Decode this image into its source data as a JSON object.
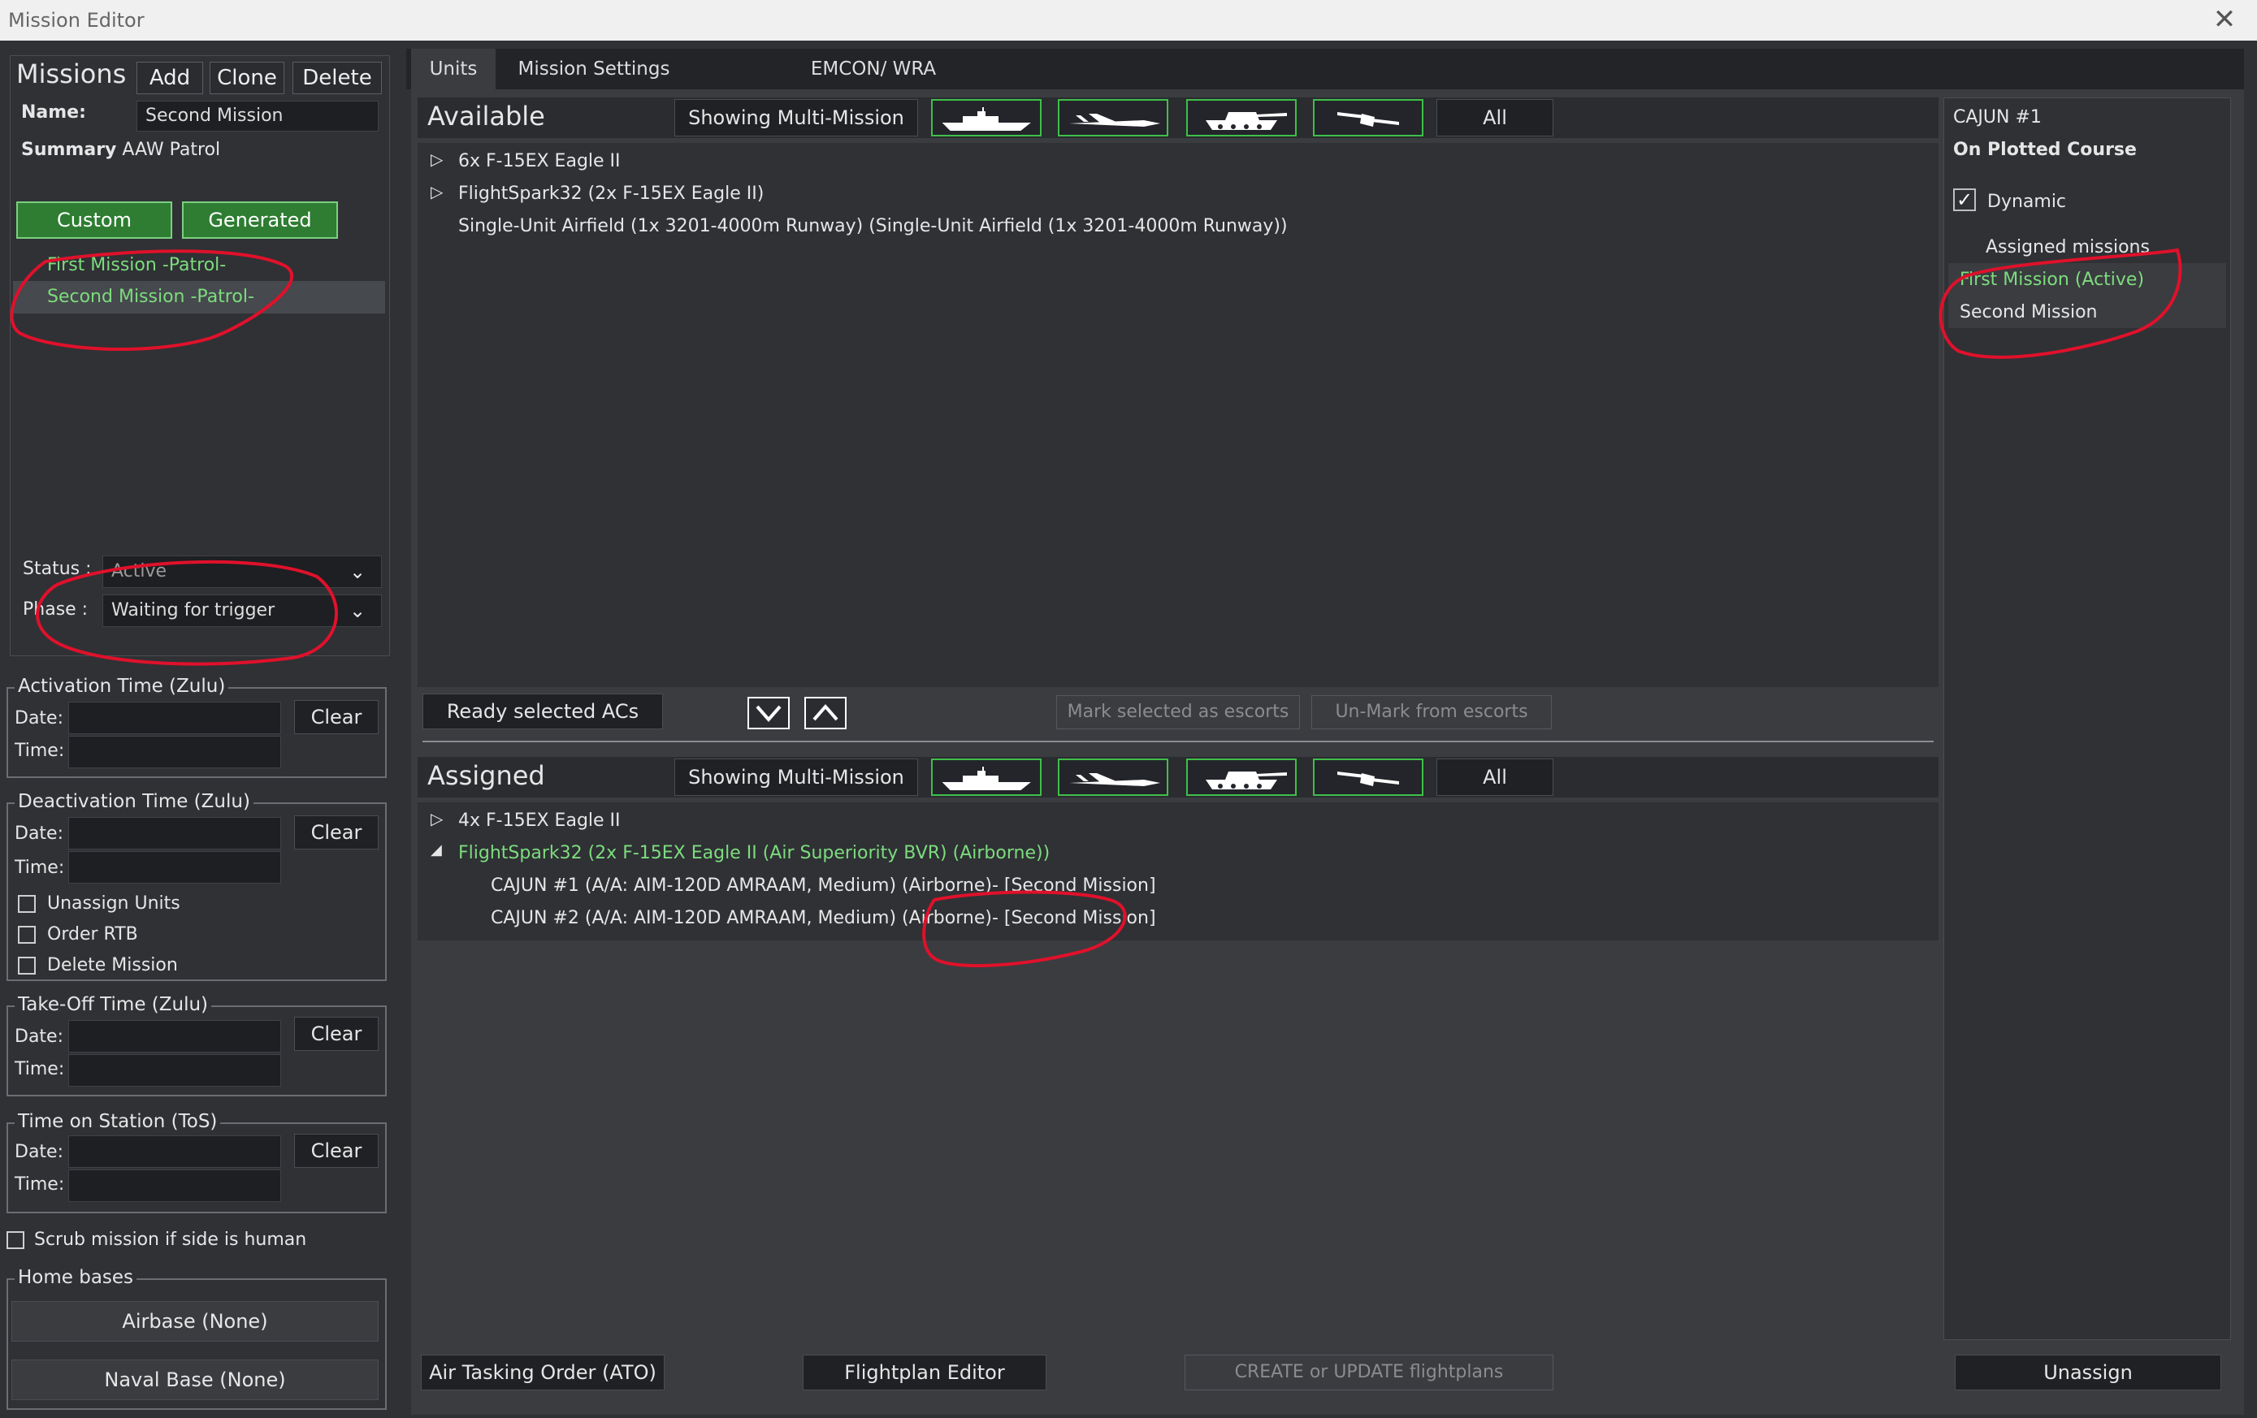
{
  "window": {
    "title": "Mission Editor"
  },
  "missions": {
    "title": "Missions",
    "add_label": "Add",
    "clone_label": "Clone",
    "delete_label": "Delete",
    "name_label": "Name:",
    "name_value": "Second Mission",
    "summary_label": "Summary",
    "summary_value": "AAW Patrol",
    "custom_label": "Custom",
    "generated_label": "Generated",
    "list": [
      "First Mission -Patrol-",
      "Second Mission -Patrol-"
    ],
    "status_label": "Status :",
    "status_value": "Active",
    "phase_label": "Phase :",
    "phase_value": "Waiting for trigger"
  },
  "times": {
    "date_label": "Date:",
    "time_label": "Time:",
    "clear_label": "Clear",
    "activation_title": "Activation Time (Zulu)",
    "deactivation_title": "Deactivation Time (Zulu)",
    "takeoff_title": "Take-Off Time (Zulu)",
    "tos_title": "Time on Station (ToS)",
    "unassign_units": "Unassign Units",
    "order_rtb": "Order RTB",
    "delete_mission": "Delete Mission",
    "scrub": "Scrub mission if side is human"
  },
  "homebases": {
    "title": "Home bases",
    "airbase": "Airbase (None)",
    "naval": "Naval Base (None)"
  },
  "tabs": [
    "Units",
    "Mission Settings",
    "EMCON/ WRA"
  ],
  "available": {
    "title": "Available",
    "showing": "Showing Multi-Mission",
    "all": "All",
    "items": [
      "6x F-15EX Eagle II",
      "FlightSpark32 (2x F-15EX Eagle II)",
      "Single-Unit Airfield (1x 3201-4000m Runway) (Single-Unit Airfield (1x 3201-4000m Runway))"
    ]
  },
  "middle": {
    "ready": "Ready selected ACs",
    "mark": "Mark selected as escorts",
    "unmark": "Un-Mark from escorts"
  },
  "assigned": {
    "title": "Assigned",
    "showing": "Showing Multi-Mission",
    "all": "All",
    "items": [
      "4x F-15EX Eagle II",
      "FlightSpark32 (2x F-15EX Eagle II (Air Superiority BVR) (Airborne))",
      "CAJUN #1 (A/A: AIM-120D AMRAAM, Medium) (Airborne)- [Second Mission]",
      "CAJUN #2 (A/A: AIM-120D AMRAAM, Medium) (Airborne)- [Second Mission]"
    ]
  },
  "right": {
    "unit": "CAJUN #1",
    "course": "On Plotted Course",
    "dynamic": "Dynamic",
    "assigned_missions": "Assigned missions",
    "missions": [
      "First Mission (Active)",
      "Second Mission"
    ],
    "unassign": "Unassign"
  },
  "bottom": {
    "ato": "Air Tasking Order (ATO)",
    "flightplan": "Flightplan Editor",
    "create": "CREATE or UPDATE flightplans"
  },
  "colors": {
    "accent_green": "#2e7d32",
    "text_green": "#7ddc7d",
    "annotation_red": "#e0112b"
  }
}
